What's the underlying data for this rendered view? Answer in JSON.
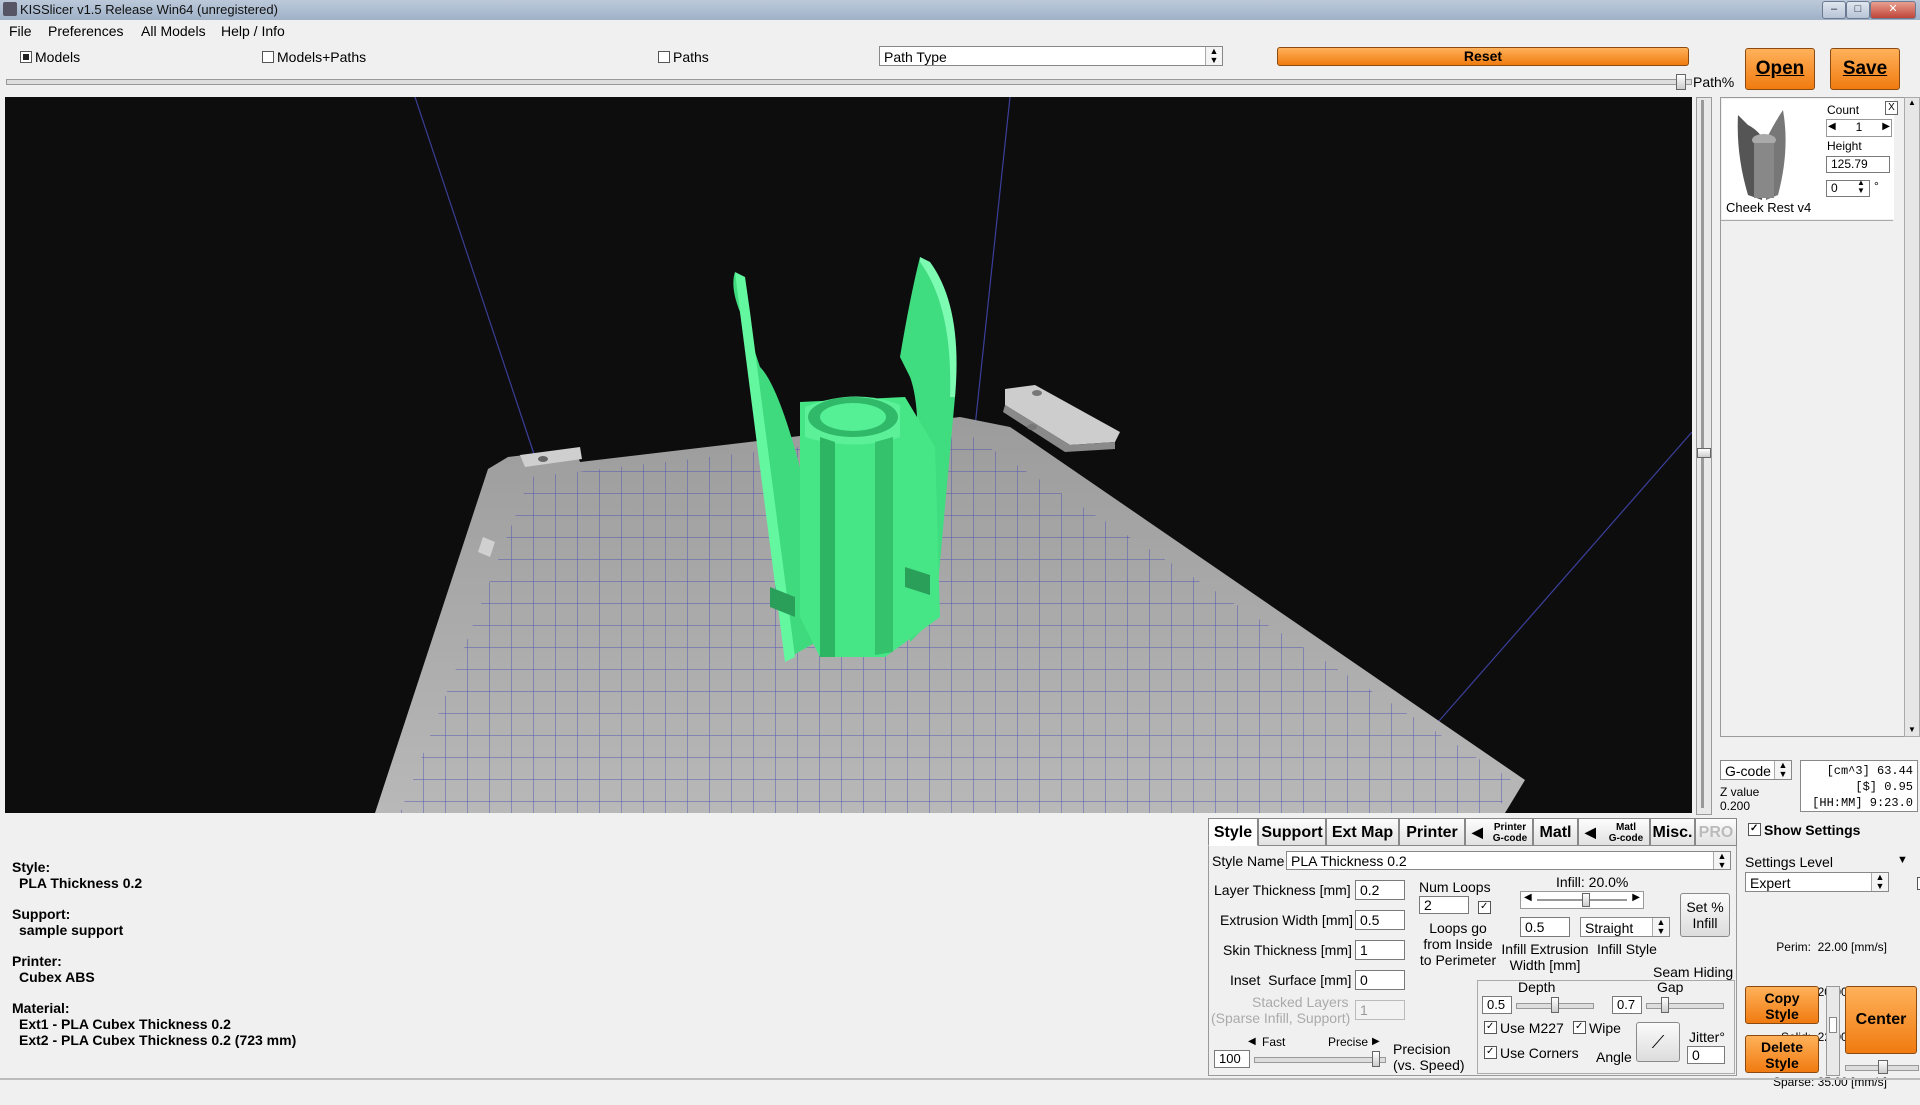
{
  "window": {
    "title": "KISSlicer v1.5 Release Win64 (unregistered)"
  },
  "menu": [
    "File",
    "Preferences",
    "All Models",
    "Help / Info"
  ],
  "toolbar": {
    "view_models": "Models",
    "view_models_paths": "Models+Paths",
    "view_paths": "Paths",
    "path_type": "Path Type",
    "reset": "Reset",
    "open": "Open",
    "save": "Save",
    "path_pct": "Path%"
  },
  "model_panel": {
    "count_label": "Count",
    "count_value": "1",
    "height_label": "Height",
    "height_value": "125.79",
    "rotation_value": "0",
    "degree": "°",
    "close": "X",
    "model_name": "Cheek Rest v4"
  },
  "stats": {
    "output_select": "G-code",
    "zvalue_label": "Z value",
    "zvalue": "0.200",
    "volume": "[cm^3] 63.44",
    "cost": "[$] 0.95",
    "time": "[HH:MM] 9:23.0"
  },
  "summary": {
    "style_label": "Style:",
    "style_value": "PLA Thickness 0.2",
    "support_label": "Support:",
    "support_value": "sample support",
    "printer_label": "Printer:",
    "printer_value": "Cubex ABS",
    "material_label": "Material:",
    "ext1": "Ext1 - PLA Cubex Thickness 0.2",
    "ext2": "Ext2 - PLA Cubex Thickness 0.2 (723 mm)"
  },
  "tabs": {
    "style": "Style",
    "support": "Support",
    "extmap": "Ext Map",
    "printer": "Printer",
    "printer_gcode_1": "Printer",
    "printer_gcode_2": "G-code",
    "matl": "Matl",
    "matl_gcode_1": "Matl",
    "matl_gcode_2": "G-code",
    "misc": "Misc.",
    "pro": "PRO"
  },
  "style_tab": {
    "style_name_label": "Style Name",
    "style_name_value": "PLA Thickness 0.2",
    "layer_thickness_label": "Layer Thickness [mm]",
    "layer_thickness_value": "0.2",
    "extrusion_width_label": "Extrusion Width [mm]",
    "extrusion_width_value": "0.5",
    "skin_thickness_label": "Skin Thickness [mm]",
    "skin_thickness_value": "1",
    "inset_surface_label": "Inset  Surface [mm]",
    "inset_surface_value": "0",
    "stacked_layers_label_1": "Stacked Layers",
    "stacked_layers_label_2": "(Sparse Infill, Support)",
    "stacked_layers_value": "1",
    "num_loops_label": "Num Loops",
    "num_loops_value": "2",
    "loops_note_1": "Loops go",
    "loops_note_2": "from Inside",
    "loops_note_3": "to Perimeter",
    "infill_label": "Infill: 20.0%",
    "infill_fraction": 0.2,
    "infill_width_value": "0.5",
    "infill_width_label_1": "Infill Extrusion",
    "infill_width_label_2": "Width [mm]",
    "infill_style_value": "Straight",
    "infill_style_label": "Infill Style",
    "set_infill_1": "Set %",
    "set_infill_2": "Infill",
    "seam_hiding_label": "Seam Hiding",
    "depth_label": "Depth",
    "depth_value": "0.5",
    "gap_label": "Gap",
    "gap_value": "0.7",
    "use_m227": "Use M227",
    "wipe": "Wipe",
    "use_corners": "Use Corners",
    "angle_label": "Angle",
    "jitter_label": "Jitter°",
    "jitter_value": "0",
    "fast_label": "Fast",
    "precise_label": "Precise",
    "precision_value": "100",
    "precision_label_1": "Precision",
    "precision_label_2": "(vs. Speed)"
  },
  "settings_panel": {
    "show_settings": "Show Settings",
    "level_label": "Settings Level",
    "level_value": "Expert",
    "perim": "Perim:  22.00 [mm/s]",
    "loops": "Loops:  20.00 [mm/s]",
    "solid": "Solid:  22.00 [mm/s]",
    "sparse": "Sparse: 35.00 [mm/s]",
    "copy_style_1": "Copy",
    "copy_style_2": "Style",
    "delete_style_1": "Delete",
    "delete_style_2": "Style",
    "center": "Center"
  },
  "colors": {
    "accent_orange": "#f07b10",
    "model_green": "#4cf08f",
    "bed_gray": "#a8a8a8",
    "grid_blue": "#4b4fb0",
    "viewport_bg": "#0d0d0d"
  }
}
